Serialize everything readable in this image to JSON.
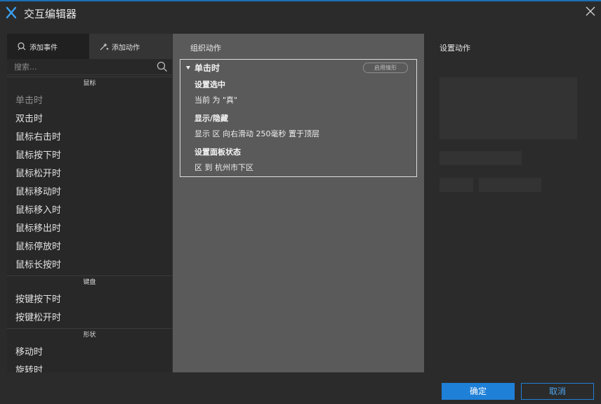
{
  "window": {
    "title": "交互编辑器",
    "logo_icon": "axure-x-logo-icon",
    "close_icon": "close-icon"
  },
  "left": {
    "tabs": [
      {
        "label": "添加事件",
        "icon": "add-event-icon",
        "active": true
      },
      {
        "label": "添加动作",
        "icon": "add-action-icon",
        "active": false
      }
    ],
    "search": {
      "placeholder": "搜索...",
      "icon": "search-icon"
    },
    "categories": [
      {
        "label": "鼠标",
        "events": [
          "单击时",
          "双击时",
          "鼠标右击时",
          "鼠标按下时",
          "鼠标松开时",
          "鼠标移动时",
          "鼠标移入时",
          "鼠标移出时",
          "鼠标停放时",
          "鼠标长按时"
        ]
      },
      {
        "label": "键盘",
        "events": [
          "按键按下时",
          "按键松开时"
        ]
      },
      {
        "label": "形状",
        "events": [
          "移动时",
          "旋转时"
        ]
      }
    ]
  },
  "middle": {
    "title": "组织动作",
    "case": {
      "event": "单击时",
      "enable_label": "启用情形",
      "actions": [
        {
          "title": "设置选中",
          "desc": "当前 为 \"真\""
        },
        {
          "title": "显示/隐藏",
          "desc": "显示 区 向右滑动 250毫秒 置于顶层"
        },
        {
          "title": "设置面板状态",
          "desc": "区 到 杭州市下区"
        }
      ]
    }
  },
  "right": {
    "title": "设置动作"
  },
  "footer": {
    "ok": "确定",
    "cancel": "取消"
  },
  "colors": {
    "accent": "#1f80d8",
    "panel_bg": "#282828",
    "middle_bg": "#5a5a5a"
  }
}
